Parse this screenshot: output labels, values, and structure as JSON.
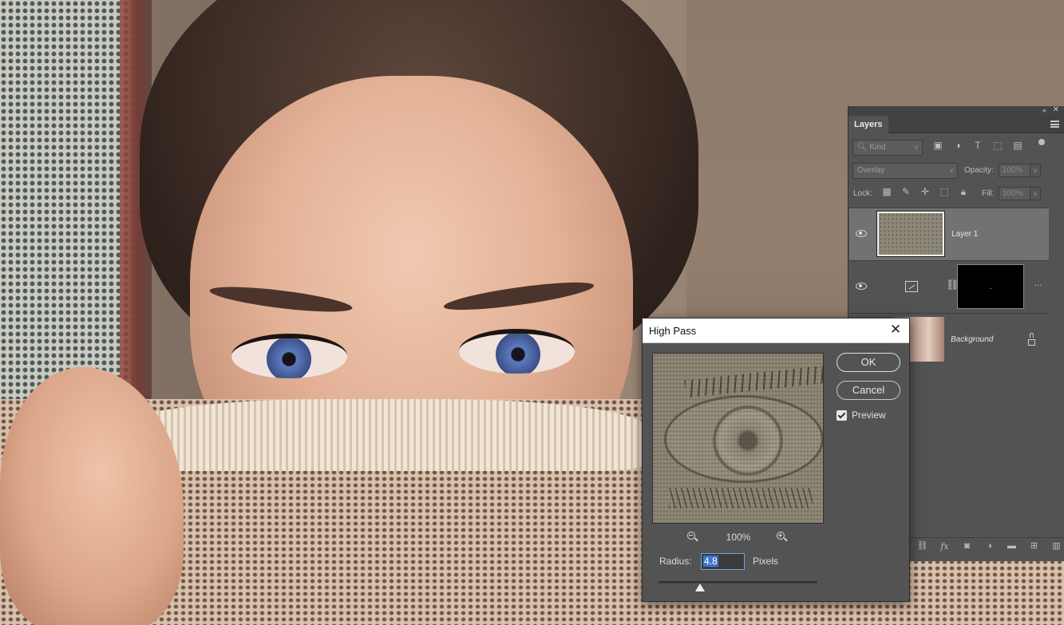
{
  "layers_panel": {
    "tab_label": "Layers",
    "filter_kind": "Kind",
    "blend_mode": "Overlay",
    "opacity_label": "Opacity:",
    "opacity_value": "100%",
    "lock_label": "Lock:",
    "fill_label": "Fill:",
    "fill_value": "100%",
    "layers": [
      {
        "name": "Layer 1",
        "visible": true,
        "selected": true
      },
      {
        "name": "",
        "visible": true,
        "selected": false,
        "type": "adjustment-with-mask"
      },
      {
        "name": "Background",
        "visible": false,
        "selected": false,
        "locked": true
      }
    ]
  },
  "dialog": {
    "title": "High Pass",
    "ok_label": "OK",
    "cancel_label": "Cancel",
    "preview_label": "Preview",
    "preview_checked": true,
    "zoom_level": "100%",
    "radius_label": "Radius:",
    "radius_value": "4.8",
    "units_label": "Pixels",
    "slider_fraction": 0.26
  },
  "colors": {
    "panel_bg": "#535353",
    "dialog_titlebar": "#ffffff",
    "selection_blue": "#3e74c9"
  }
}
